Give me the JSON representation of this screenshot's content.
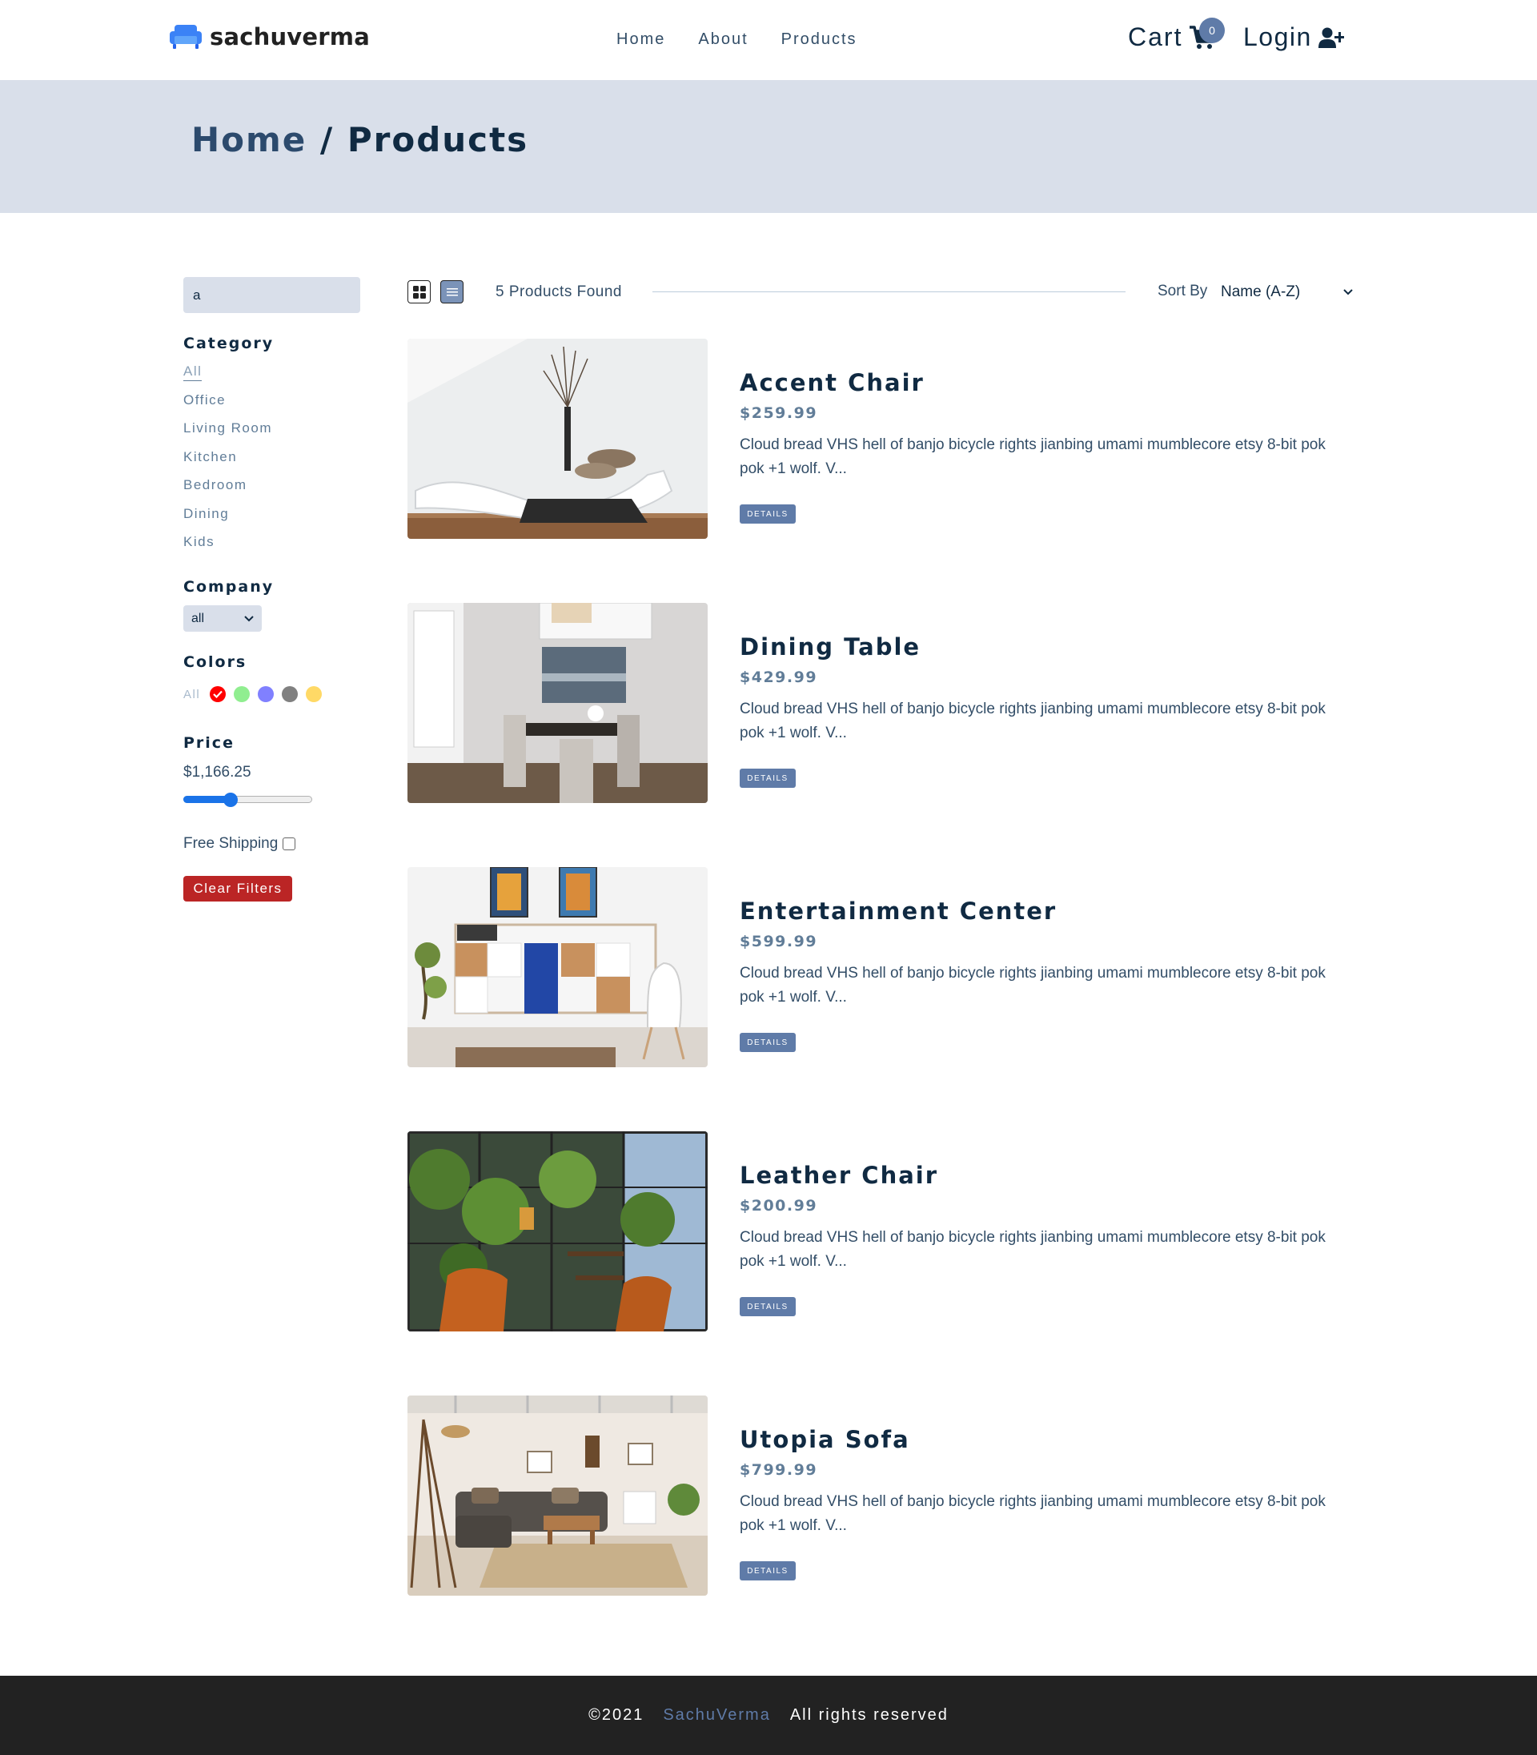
{
  "navbar": {
    "brand": "sachuverma",
    "links": [
      "Home",
      "About",
      "Products"
    ],
    "cart_label": "Cart",
    "cart_count": "0",
    "login_label": "Login"
  },
  "hero": {
    "crumb_home": "Home",
    "separator": "/",
    "crumb_current": "Products"
  },
  "filters": {
    "search_value": "a",
    "category_heading": "Category",
    "categories": [
      "All",
      "Office",
      "Living Room",
      "Kitchen",
      "Bedroom",
      "Dining",
      "Kids"
    ],
    "active_category": "All",
    "company_heading": "Company",
    "company_selected": "all",
    "colors_heading": "Colors",
    "colors_all_label": "All",
    "colors": [
      "#ff0000",
      "#90ee90",
      "#8080ff",
      "#808080",
      "#ffd966"
    ],
    "active_color": "#ff0000",
    "price_heading": "Price",
    "price_value": "$1,166.25",
    "price_fraction": 0.35,
    "free_shipping_label": "Free Shipping",
    "free_shipping_checked": false,
    "clear_label": "Clear Filters"
  },
  "sort": {
    "count_label": "5 Products Found",
    "sort_label": "Sort By",
    "sort_selected": "Name (A-Z)",
    "view_mode": "list"
  },
  "products": [
    {
      "name": "Accent Chair",
      "price": "$259.99",
      "description": "Cloud bread VHS hell of banjo bicycle rights jianbing umami mumblecore etsy 8-bit pok pok +1 wolf. V...",
      "button": "DETAILS",
      "image": "white-chaise-lounge"
    },
    {
      "name": "Dining Table",
      "price": "$429.99",
      "description": "Cloud bread VHS hell of banjo bicycle rights jianbing umami mumblecore etsy 8-bit pok pok +1 wolf. V...",
      "button": "DETAILS",
      "image": "dining-room"
    },
    {
      "name": "Entertainment Center",
      "price": "$599.99",
      "description": "Cloud bread VHS hell of banjo bicycle rights jianbing umami mumblecore etsy 8-bit pok pok +1 wolf. V...",
      "button": "DETAILS",
      "image": "cabinet-shelving"
    },
    {
      "name": "Leather Chair",
      "price": "$200.99",
      "description": "Cloud bread VHS hell of banjo bicycle rights jianbing umami mumblecore etsy 8-bit pok pok +1 wolf. V...",
      "button": "DETAILS",
      "image": "plant-room-leather-chair"
    },
    {
      "name": "Utopia Sofa",
      "price": "$799.99",
      "description": "Cloud bread VHS hell of banjo bicycle rights jianbing umami mumblecore etsy 8-bit pok pok +1 wolf. V...",
      "button": "DETAILS",
      "image": "living-room-sofa"
    }
  ],
  "footer": {
    "copyright": "©2021",
    "brand": "SachuVerma",
    "rights": "All rights reserved"
  },
  "theme": {
    "primary": "#5f7ba8",
    "hero_bg": "#d9dfea",
    "danger": "#bb2525",
    "footer_bg": "#222222"
  }
}
